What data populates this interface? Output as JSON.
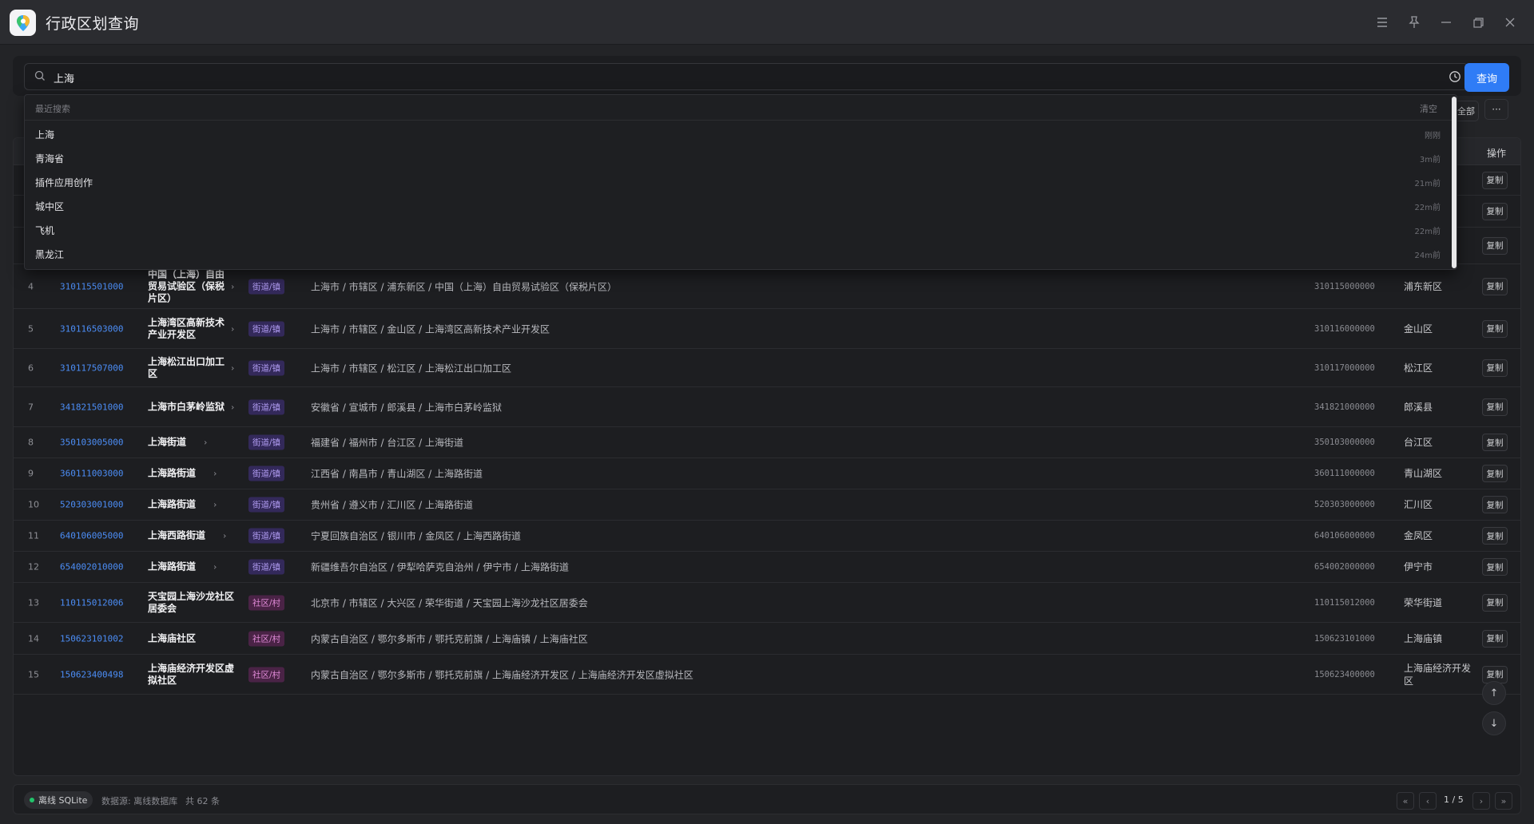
{
  "window": {
    "title": "行政区划查询"
  },
  "search": {
    "value": "上海",
    "button": "查询"
  },
  "toolbar": {
    "all_label": "全部",
    "more_label": "···"
  },
  "dropdown": {
    "header": "最近搜索",
    "clear": "清空",
    "items": [
      {
        "text": "上海",
        "time": "刚刚"
      },
      {
        "text": "青海省",
        "time": "3m前"
      },
      {
        "text": "插件应用创作",
        "time": "21m前"
      },
      {
        "text": "城中区",
        "time": "22m前"
      },
      {
        "text": "飞机",
        "time": "22m前"
      },
      {
        "text": "黑龙江",
        "time": "24m前"
      }
    ]
  },
  "table": {
    "op_header": "操作",
    "copy_label": "复制",
    "rows": [
      {
        "idx": "4",
        "code": "310115501000",
        "name": "中国（上海）自由贸易试验区（保税片区）",
        "tag": "街道/镇",
        "path": "上海市 / 市辖区 / 浦东新区 / 中国（上海）自由贸易试验区（保税片区）",
        "pcode": "310115000000",
        "parent": "浦东新区"
      },
      {
        "idx": "5",
        "code": "310116503000",
        "name": "上海湾区高新技术产业开发区",
        "tag": "街道/镇",
        "path": "上海市 / 市辖区 / 金山区 / 上海湾区高新技术产业开发区",
        "pcode": "310116000000",
        "parent": "金山区"
      },
      {
        "idx": "6",
        "code": "310117507000",
        "name": "上海松江出口加工区",
        "tag": "街道/镇",
        "path": "上海市 / 市辖区 / 松江区 / 上海松江出口加工区",
        "pcode": "310117000000",
        "parent": "松江区"
      },
      {
        "idx": "7",
        "code": "341821501000",
        "name": "上海市白茅岭监狱",
        "tag": "街道/镇",
        "path": "安徽省 / 宣城市 / 郎溪县 / 上海市白茅岭监狱",
        "pcode": "341821000000",
        "parent": "郎溪县"
      },
      {
        "idx": "8",
        "code": "350103005000",
        "name": "上海街道",
        "tag": "街道/镇",
        "path": "福建省 / 福州市 / 台江区 / 上海街道",
        "pcode": "350103000000",
        "parent": "台江区"
      },
      {
        "idx": "9",
        "code": "360111003000",
        "name": "上海路街道",
        "tag": "街道/镇",
        "path": "江西省 / 南昌市 / 青山湖区 / 上海路街道",
        "pcode": "360111000000",
        "parent": "青山湖区"
      },
      {
        "idx": "10",
        "code": "520303001000",
        "name": "上海路街道",
        "tag": "街道/镇",
        "path": "贵州省 / 遵义市 / 汇川区 / 上海路街道",
        "pcode": "520303000000",
        "parent": "汇川区"
      },
      {
        "idx": "11",
        "code": "640106005000",
        "name": "上海西路街道",
        "tag": "街道/镇",
        "path": "宁夏回族自治区 / 银川市 / 金凤区 / 上海西路街道",
        "pcode": "640106000000",
        "parent": "金凤区"
      },
      {
        "idx": "12",
        "code": "654002010000",
        "name": "上海路街道",
        "tag": "街道/镇",
        "path": "新疆维吾尔自治区 / 伊犁哈萨克自治州 / 伊宁市 / 上海路街道",
        "pcode": "654002000000",
        "parent": "伊宁市"
      },
      {
        "idx": "13",
        "code": "110115012006",
        "name": "天宝园上海沙龙社区居委会",
        "tag": "社区/村",
        "path": "北京市 / 市辖区 / 大兴区 / 荣华街道 / 天宝园上海沙龙社区居委会",
        "pcode": "110115012000",
        "parent": "荣华街道"
      },
      {
        "idx": "14",
        "code": "150623101002",
        "name": "上海庙社区",
        "tag": "社区/村",
        "path": "内蒙古自治区 / 鄂尔多斯市 / 鄂托克前旗 / 上海庙镇 / 上海庙社区",
        "pcode": "150623101000",
        "parent": "上海庙镇"
      },
      {
        "idx": "15",
        "code": "150623400498",
        "name": "上海庙经济开发区虚拟社区",
        "tag": "社区/村",
        "path": "内蒙古自治区 / 鄂尔多斯市 / 鄂托克前旗 / 上海庙经济开发区 / 上海庙经济开发区虚拟社区",
        "pcode": "150623400000",
        "parent": "上海庙经济开发区"
      }
    ]
  },
  "status": {
    "db_label": "离线 SQLite",
    "source": "数据源: 离线数据库",
    "total": "共 62 条",
    "page": "1 / 5"
  },
  "colors": {
    "accent": "#2f7cf6",
    "street_tag": "#b19cf2",
    "community_tag": "#e08ad7",
    "online_dot": "#22c36b"
  }
}
